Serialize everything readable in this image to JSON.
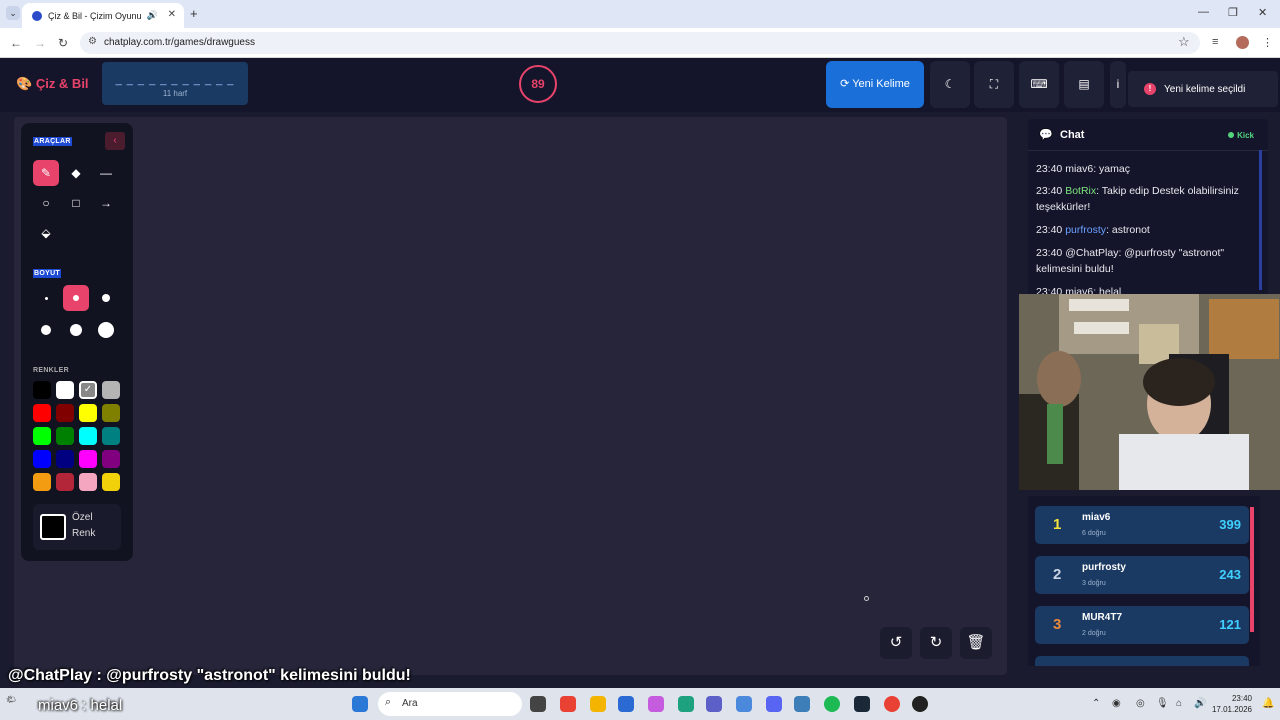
{
  "browser": {
    "tab_title": "Çiz & Bil - Çizim Oyunu",
    "url": "chatplay.com.tr/games/drawguess"
  },
  "header": {
    "logo": "Çiz & Bil",
    "word_dashes": "_ _ _ _ _ _ _ _ _ _ _",
    "letter_count": "11 harf",
    "timer": "89",
    "new_word_label": "Yeni Kelime",
    "toast": "Yeni kelime seçildi"
  },
  "tools": {
    "tools_label": "ARAÇLAR",
    "size_label": "BOYUT",
    "colors_label": "RENKLER",
    "custom_color_line1": "Özel",
    "custom_color_line2": "Renk",
    "colors": [
      "#000000",
      "#ffffff",
      "#888888",
      "#b4b4b4",
      "#ff0000",
      "#800000",
      "#ffff00",
      "#808000",
      "#00ff00",
      "#008000",
      "#00ffff",
      "#008080",
      "#0000ff",
      "#000080",
      "#ff00ff",
      "#800080",
      "#f39c12",
      "#b3263a",
      "#f4a6c1",
      "#f1d20a"
    ]
  },
  "chat": {
    "title": "Chat",
    "status": "Kick",
    "messages": [
      {
        "time": "23:40",
        "user": "miav6",
        "text": ": yamaç"
      },
      {
        "time": "23:40",
        "user": "BotRix",
        "text": ": Takip edip Destek olabilirsiniz teşekkürler!"
      },
      {
        "time": "23:40",
        "user": "purfrosty",
        "text": ": astronot"
      },
      {
        "time": "23:40",
        "user": "@ChatPlay",
        "text": ": @purfrosty \"astronot\" kelimesini buldu!"
      },
      {
        "time": "23:40",
        "user": "miav6",
        "text": ": helal"
      }
    ]
  },
  "leaderboard": [
    {
      "rank": "1",
      "name": "miav6",
      "correct": "6 doğru",
      "score": "399",
      "color": "#f5e23b"
    },
    {
      "rank": "2",
      "name": "purfrosty",
      "correct": "3 doğru",
      "score": "243",
      "color": "#c7d3e4"
    },
    {
      "rank": "3",
      "name": "MUR4T7",
      "correct": "2 doğru",
      "score": "121",
      "color": "#e88a3c"
    }
  ],
  "overlay": {
    "line1": "@ChatPlay : @purfrosty \"astronot\" kelimesini buldu!",
    "line2": "miav6 : helal"
  },
  "taskbar": {
    "search_placeholder": "Ara",
    "time": "23:40",
    "date": "17.01.2026"
  }
}
